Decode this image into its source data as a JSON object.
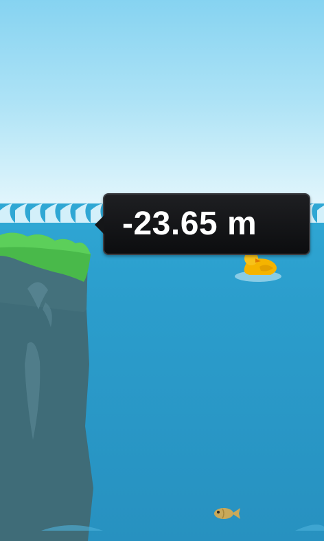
{
  "hud": {
    "depth_readout": "-23.65 m"
  },
  "scene": {
    "player": "duck",
    "creatures": [
      "fish"
    ],
    "terrain": "grassy-cliff"
  },
  "colors": {
    "sky_top": "#86d3f1",
    "sky_horizon": "#e3f6fc",
    "water": "#2b9dcc",
    "cliff": "#3f6c78",
    "grass": "#49b94a",
    "duck": "#f5b400",
    "fish": "#c9a95a",
    "tooltip_bg": "#111214"
  }
}
